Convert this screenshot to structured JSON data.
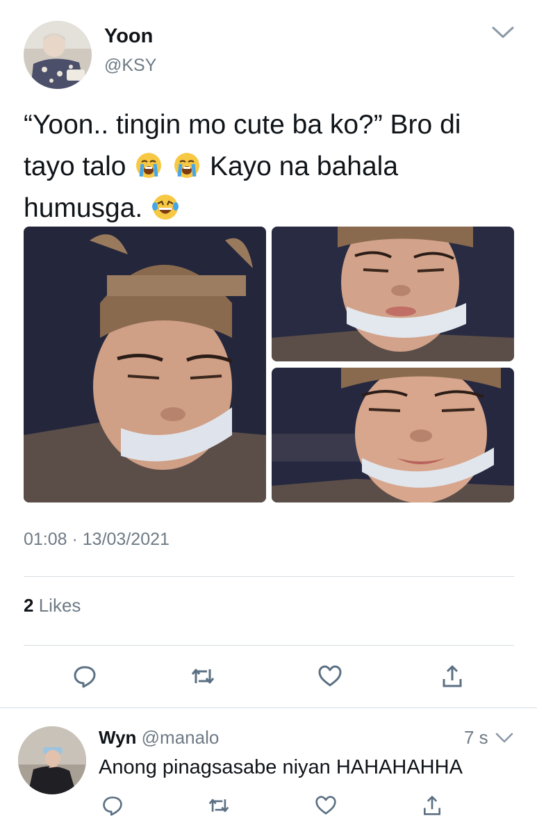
{
  "tweet": {
    "author": {
      "name": "Yoon",
      "handle": "@KSY",
      "avatar_icon": "profile-photo"
    },
    "text_parts": {
      "line1": "“Yoon.. tingin mo cute ba ko?” Bro di",
      "line2a": "tayo talo",
      "emoji_crying": "😭",
      "line2b": "Kayo na bahala",
      "line3": "humusga.",
      "emoji_laughing": "😂"
    },
    "timestamp": "01:08 · 13/03/2021",
    "likes": {
      "count": "2",
      "label": "Likes"
    },
    "photos": [
      "selfie-photo-1",
      "selfie-photo-2",
      "selfie-photo-3"
    ],
    "actions": [
      "reply-icon",
      "retweet-icon",
      "like-icon",
      "share-icon"
    ]
  },
  "reply": {
    "name": "Wyn",
    "handle": "@manalo",
    "time": "7 s",
    "text": "Anong pinagsasabe niyan HAHAHAHHA",
    "actions": [
      "reply-icon",
      "retweet-icon",
      "like-icon",
      "share-icon"
    ]
  },
  "colors": {
    "text": "#0f1419",
    "secondary": "#6e7a85",
    "divider": "#d7dde2",
    "icon": "#5b7083"
  }
}
